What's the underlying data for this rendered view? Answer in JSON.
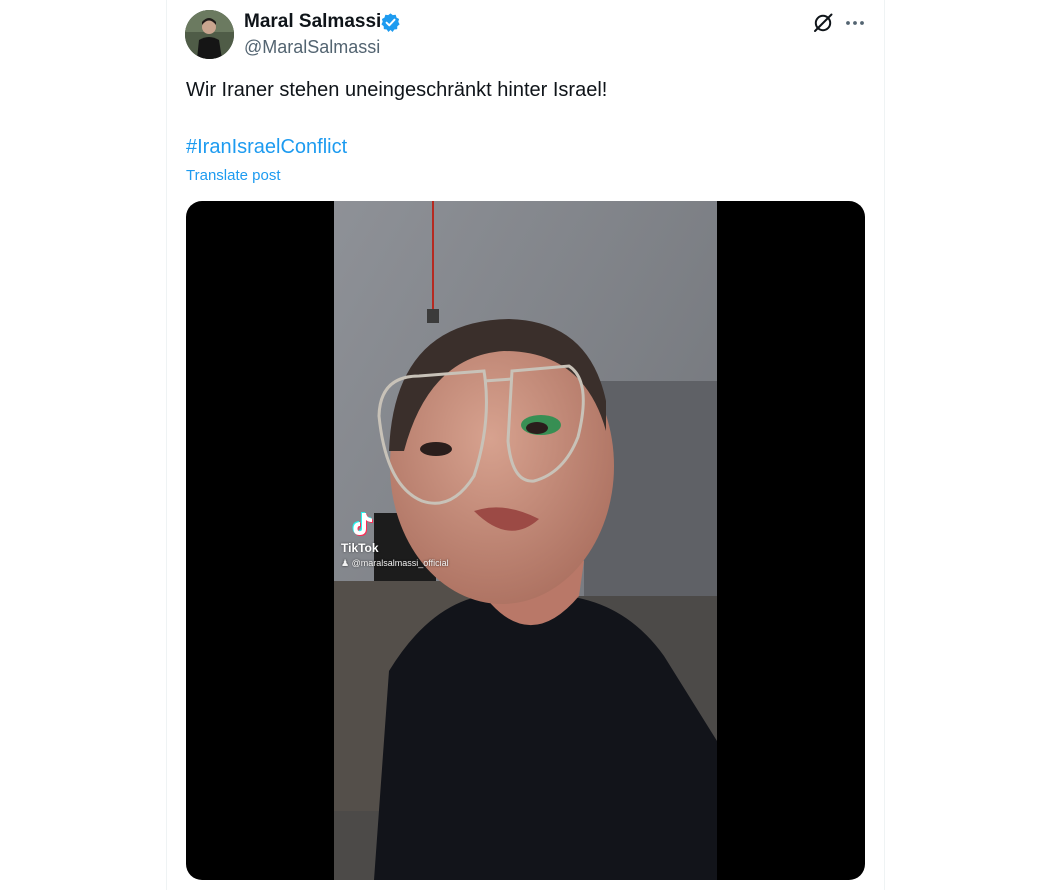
{
  "post": {
    "author_name": "Maral Salmassi",
    "author_handle": "@MaralSalmassi",
    "text": "Wir Iraner stehen uneingeschränkt hinter Israel!",
    "hashtag": "#IranIsraelConflict",
    "translate_label": "Translate post"
  },
  "icons": {
    "verified": "verified-badge-icon",
    "grok": "grok-icon",
    "more": "more-options-icon",
    "tiktok": "tiktok-logo-icon"
  },
  "video_overlay": {
    "brand": "TikTok",
    "username": "@maralsalmassi_official"
  },
  "colors": {
    "accent": "#1d9bf0",
    "text_primary": "#0f1419",
    "text_secondary": "#536471",
    "media_background": "#000000"
  }
}
